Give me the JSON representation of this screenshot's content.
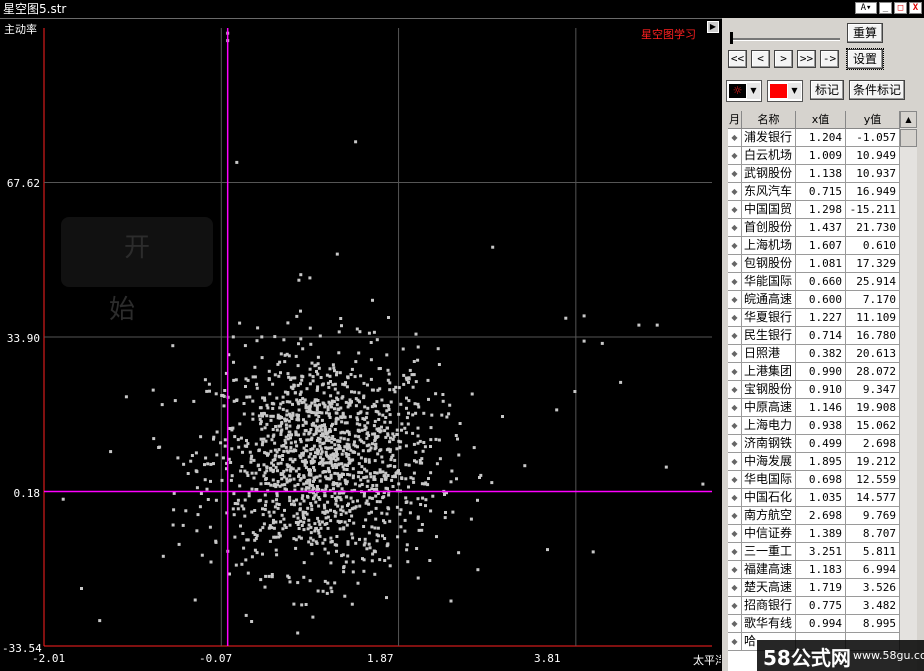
{
  "window": {
    "title": "星空图5.str",
    "buttons": [
      "A",
      "▾",
      "_",
      "□",
      "X"
    ]
  },
  "chart": {
    "y_axis_title": "主动率",
    "corner_label": "星空图学习",
    "start_button": "开 始",
    "expand_icon": "expand-icon",
    "y_ticks": [
      "67.62",
      "33.90",
      "0.18",
      "-33.54"
    ],
    "x_ticks": [
      "-2.01",
      "-0.07",
      "1.87",
      "3.81",
      "太平洋"
    ],
    "colors": {
      "background": "#000000",
      "grid": "#555555",
      "crosshair": "#ff00ff",
      "points": "#c8c8c8",
      "axis": "#ff0000"
    }
  },
  "chart_data": {
    "type": "scatter",
    "title": "",
    "xlabel": "",
    "ylabel": "主动率",
    "xlim": [
      -2.01,
      5.3
    ],
    "ylim": [
      -33.54,
      101.34
    ],
    "x_ticks": [
      -2.01,
      -0.07,
      1.87,
      3.81
    ],
    "y_ticks": [
      -33.54,
      0.18,
      33.9,
      67.62
    ],
    "crosshair": {
      "x": 0,
      "y": 0.18
    },
    "grid": true,
    "description_points": "dense cloud centered near x≈1.0, y≈8; outliers up to y≈100",
    "points_sample": [
      [
        1.204,
        -1.057
      ],
      [
        1.009,
        10.949
      ],
      [
        1.138,
        10.937
      ],
      [
        0.715,
        16.949
      ],
      [
        1.298,
        -15.211
      ],
      [
        1.437,
        21.73
      ],
      [
        1.607,
        0.61
      ],
      [
        1.081,
        17.329
      ],
      [
        0.66,
        25.914
      ],
      [
        0.6,
        7.17
      ],
      [
        1.227,
        11.109
      ],
      [
        0.714,
        16.78
      ],
      [
        0.382,
        20.613
      ],
      [
        0.99,
        28.072
      ],
      [
        0.91,
        9.347
      ],
      [
        1.146,
        19.908
      ],
      [
        0.938,
        15.062
      ],
      [
        0.499,
        2.698
      ],
      [
        1.895,
        19.212
      ],
      [
        0.698,
        12.559
      ],
      [
        1.035,
        14.577
      ],
      [
        2.698,
        9.769
      ],
      [
        1.389,
        8.707
      ],
      [
        3.251,
        5.811
      ],
      [
        1.183,
        6.994
      ],
      [
        1.719,
        3.526
      ],
      [
        0.775,
        3.482
      ],
      [
        0.994,
        8.995
      ]
    ]
  },
  "panel": {
    "recalc_label": "重算",
    "settings_label": "设置",
    "nav": [
      "<<",
      "<",
      ">",
      ">>",
      "->"
    ],
    "mark_label": "标记",
    "cond_mark_label": "条件标记",
    "swatch1_color": "#ff0000",
    "swatch2_color": "#ff0000",
    "table_headers": [
      "月",
      "名称",
      "x值",
      "y值"
    ],
    "rows": [
      {
        "name": "浦发银行",
        "x": "1.204",
        "y": "-1.057"
      },
      {
        "name": "白云机场",
        "x": "1.009",
        "y": "10.949"
      },
      {
        "name": "武钢股份",
        "x": "1.138",
        "y": "10.937"
      },
      {
        "name": "东风汽车",
        "x": "0.715",
        "y": "16.949"
      },
      {
        "name": "中国国贸",
        "x": "1.298",
        "y": "-15.211"
      },
      {
        "name": "首创股份",
        "x": "1.437",
        "y": "21.730"
      },
      {
        "name": "上海机场",
        "x": "1.607",
        "y": "0.610"
      },
      {
        "name": "包钢股份",
        "x": "1.081",
        "y": "17.329"
      },
      {
        "name": "华能国际",
        "x": "0.660",
        "y": "25.914"
      },
      {
        "name": "皖通高速",
        "x": "0.600",
        "y": "7.170"
      },
      {
        "name": "华夏银行",
        "x": "1.227",
        "y": "11.109"
      },
      {
        "name": "民生银行",
        "x": "0.714",
        "y": "16.780"
      },
      {
        "name": "日照港",
        "x": "0.382",
        "y": "20.613"
      },
      {
        "name": "上港集团",
        "x": "0.990",
        "y": "28.072"
      },
      {
        "name": "宝钢股份",
        "x": "0.910",
        "y": "9.347"
      },
      {
        "name": "中原高速",
        "x": "1.146",
        "y": "19.908"
      },
      {
        "name": "上海电力",
        "x": "0.938",
        "y": "15.062"
      },
      {
        "name": "济南钢铁",
        "x": "0.499",
        "y": "2.698"
      },
      {
        "name": "中海发展",
        "x": "1.895",
        "y": "19.212"
      },
      {
        "name": "华电国际",
        "x": "0.698",
        "y": "12.559"
      },
      {
        "name": "中国石化",
        "x": "1.035",
        "y": "14.577"
      },
      {
        "name": "南方航空",
        "x": "2.698",
        "y": "9.769"
      },
      {
        "name": "中信证券",
        "x": "1.389",
        "y": "8.707"
      },
      {
        "name": "三一重工",
        "x": "3.251",
        "y": "5.811"
      },
      {
        "name": "福建高速",
        "x": "1.183",
        "y": "6.994"
      },
      {
        "name": "楚天高速",
        "x": "1.719",
        "y": "3.526"
      },
      {
        "name": "招商银行",
        "x": "0.775",
        "y": "3.482"
      },
      {
        "name": "歌华有线",
        "x": "0.994",
        "y": "8.995"
      },
      {
        "name": "哈",
        "x": "",
        "y": ""
      }
    ]
  },
  "site_watermark": {
    "big": "58公式网",
    "small": "www.58gu.com"
  }
}
